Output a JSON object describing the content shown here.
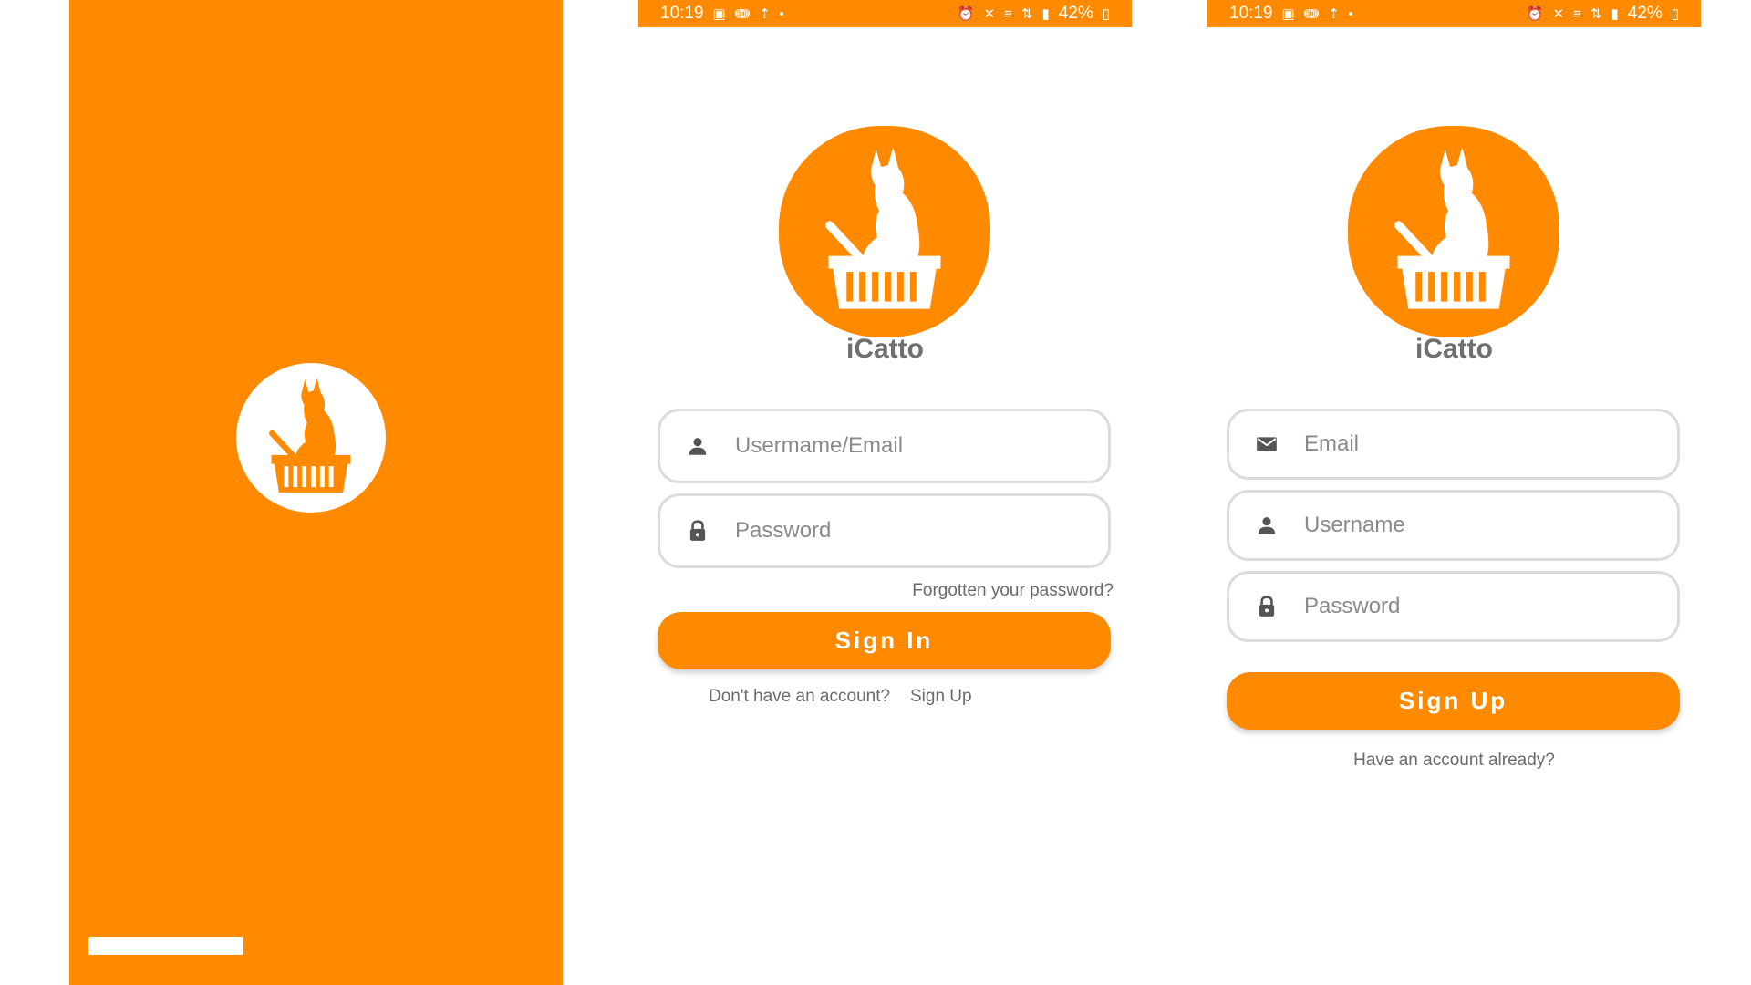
{
  "colors": {
    "brand": "#FF8A00",
    "background": "#FFFFFF",
    "input_border": "#DCDCDC",
    "text_muted": "#6A6A6A"
  },
  "status_bar": {
    "time": "10:19",
    "battery": "42%",
    "left_icons": [
      "image-icon",
      "nfc-icon",
      "upload-icon"
    ],
    "right_icons": [
      "alarm-icon",
      "mute-icon",
      "volte-icon",
      "4g-icon",
      "signal-icon",
      "battery-icon"
    ]
  },
  "splash": {
    "logo_icon": "cat-basket-logo-icon"
  },
  "signin": {
    "app_name": "iCatto",
    "username_placeholder": "Usermame/Email",
    "password_placeholder": "Password",
    "forgot_password": "Forgotten your password?",
    "sign_in_button": "Sign In",
    "no_account_text": "Don't have an account?",
    "sign_up_link": "Sign Up"
  },
  "signup": {
    "app_name": "iCatto",
    "email_placeholder": "Email",
    "username_placeholder": "Username",
    "password_placeholder": "Password",
    "sign_up_button": "Sign Up",
    "have_account_text": "Have an account already?"
  }
}
